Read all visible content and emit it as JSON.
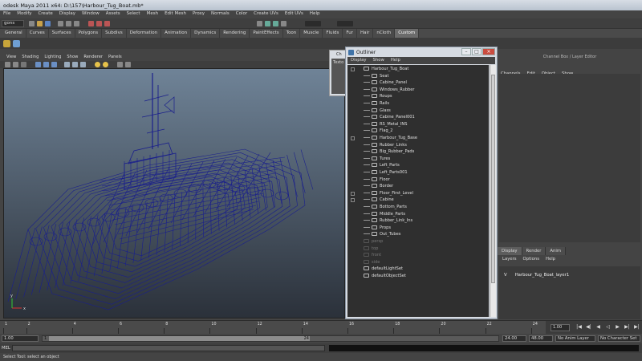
{
  "window": {
    "title": "odesk Maya 2011 x64: D:\\157\\Harbour_Tug_Boat.mb*"
  },
  "main_menu": [
    "File",
    "Modify",
    "Create",
    "Display",
    "Window",
    "Assets",
    "Select",
    "Mesh",
    "Edit Mesh",
    "Proxy",
    "Normals",
    "Color",
    "Create UVs",
    "Edit UVs",
    "Help"
  ],
  "status_line": {
    "mode": "gons"
  },
  "shelf": {
    "tabs": [
      "General",
      "Curves",
      "Surfaces",
      "Polygons",
      "Subdivs",
      "Deformation",
      "Animation",
      "Dynamics",
      "Rendering",
      "PaintEffects",
      "Toon",
      "Muscle",
      "Fluids",
      "Fur",
      "Hair",
      "nCloth",
      "Custom"
    ],
    "active": "Custom"
  },
  "viewport": {
    "menu": [
      "View",
      "Shading",
      "Lighting",
      "Show",
      "Renderer",
      "Panels"
    ],
    "axis": {
      "x": "x",
      "y": "y"
    },
    "wire_color": "#1a1f8c"
  },
  "help_window": {
    "title": "Ch",
    "tab": "Texto"
  },
  "outliner": {
    "title": "Outliner",
    "menu": [
      "Display",
      "Show",
      "Help"
    ],
    "items": [
      {
        "name": "Harbour_Tug_Boat",
        "level": 0,
        "dim": false,
        "expandable": true
      },
      {
        "name": "Seat",
        "level": 1,
        "dim": false
      },
      {
        "name": "Cabine_Panel",
        "level": 1,
        "dim": false
      },
      {
        "name": "Windows_Rubber",
        "level": 1,
        "dim": false
      },
      {
        "name": "Roups",
        "level": 1,
        "dim": false
      },
      {
        "name": "Rails",
        "level": 1,
        "dim": false
      },
      {
        "name": "Glass",
        "level": 1,
        "dim": false
      },
      {
        "name": "Cabine_Panel001",
        "level": 1,
        "dim": false
      },
      {
        "name": "RS_Metal_INS",
        "level": 1,
        "dim": false
      },
      {
        "name": "Flag_2",
        "level": 1,
        "dim": false
      },
      {
        "name": "Harbour_Tug_Base",
        "level": 1,
        "dim": false,
        "expandable": true
      },
      {
        "name": "Rubber_Links",
        "level": 1,
        "dim": false
      },
      {
        "name": "Big_Rubber_Pads",
        "level": 1,
        "dim": false
      },
      {
        "name": "Tures",
        "level": 1,
        "dim": false
      },
      {
        "name": "Left_Parts",
        "level": 1,
        "dim": false
      },
      {
        "name": "Left_Parts001",
        "level": 1,
        "dim": false
      },
      {
        "name": "Floor",
        "level": 1,
        "dim": false
      },
      {
        "name": "Border",
        "level": 1,
        "dim": false
      },
      {
        "name": "Floor_First_Level",
        "level": 1,
        "dim": false,
        "expandable": true
      },
      {
        "name": "Cabine",
        "level": 1,
        "dim": false,
        "expandable": true
      },
      {
        "name": "Bottom_Parts",
        "level": 1,
        "dim": false
      },
      {
        "name": "Middle_Parts",
        "level": 1,
        "dim": false
      },
      {
        "name": "Rubber_Link_Ins",
        "level": 1,
        "dim": false
      },
      {
        "name": "Props",
        "level": 1,
        "dim": false
      },
      {
        "name": "Out_Tubes",
        "level": 1,
        "dim": false
      },
      {
        "name": "persp",
        "level": 0,
        "dim": true
      },
      {
        "name": "top",
        "level": 0,
        "dim": true
      },
      {
        "name": "front",
        "level": 0,
        "dim": true
      },
      {
        "name": "side",
        "level": 0,
        "dim": true
      },
      {
        "name": "defaultLightSet",
        "level": 0,
        "dim": false
      },
      {
        "name": "defaultObjectSet",
        "level": 0,
        "dim": false
      }
    ]
  },
  "channel_box": {
    "title": "Channel Box / Layer Editor",
    "menu": [
      "Channels",
      "Edit",
      "Object",
      "Show"
    ]
  },
  "layer_editor": {
    "tabs": [
      "Display",
      "Render",
      "Anim"
    ],
    "active": "Display",
    "menu": [
      "Layers",
      "Options",
      "Help"
    ],
    "layers": [
      {
        "visible": "V",
        "name": "Harbour_Tug_Boat_layer1"
      }
    ]
  },
  "timeline": {
    "ticks": [
      "1",
      "2",
      "4",
      "6",
      "8",
      "10",
      "12",
      "14",
      "16",
      "18",
      "20",
      "22",
      "24"
    ],
    "current_frame": "1.00"
  },
  "range": {
    "start": "1.00",
    "inner_start": "1.00",
    "handle_start": "1",
    "handle_end": "24",
    "end_inner": "24.00",
    "end": "48.00",
    "anim_layer": "No Anim Layer",
    "character_set": "No Character Set"
  },
  "command_line": {
    "label": "MEL"
  },
  "help_line": {
    "text": "Select Tool: select an object"
  }
}
